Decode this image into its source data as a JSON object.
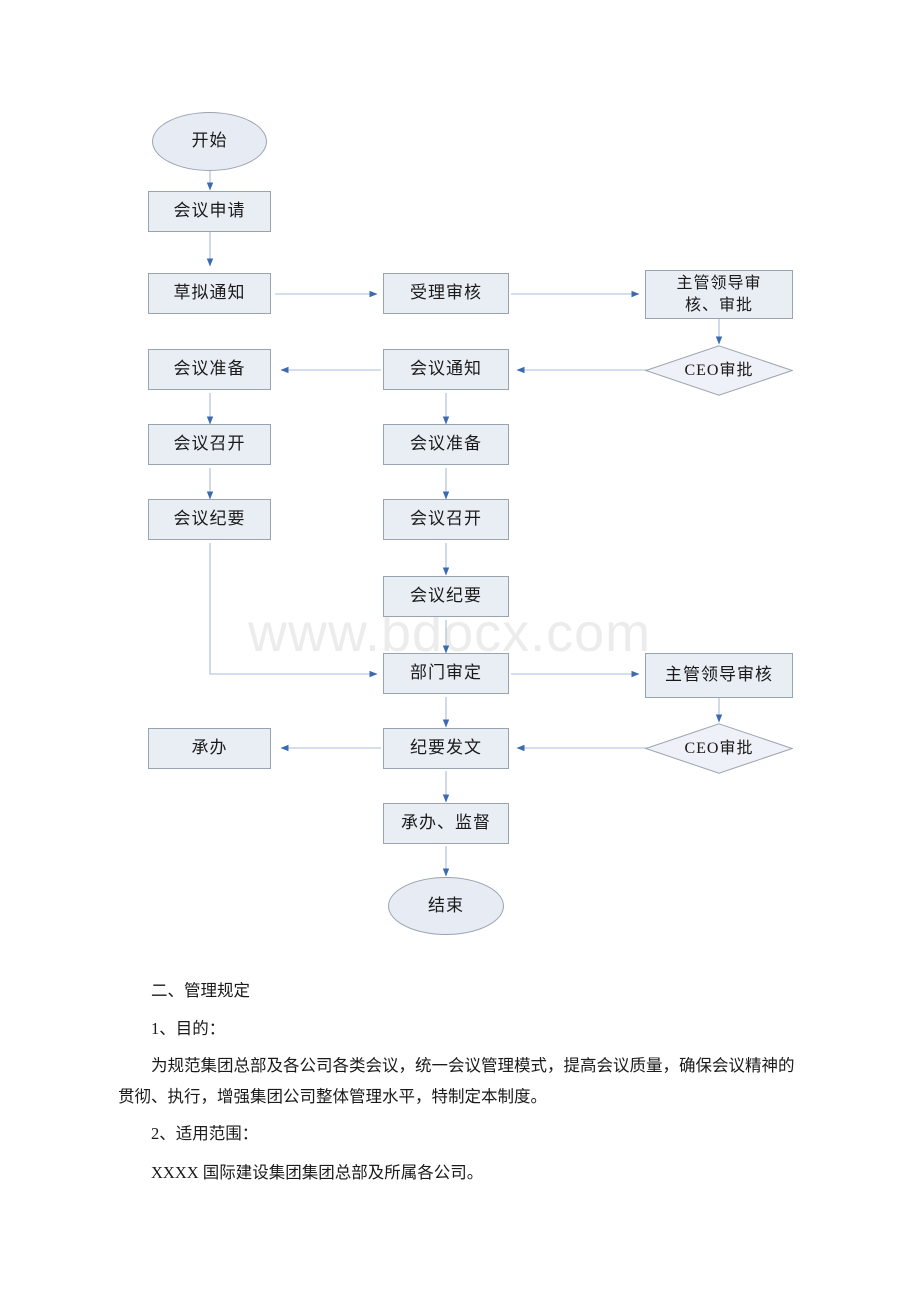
{
  "watermark": {
    "text": "www.bdocx.com"
  },
  "flowchart": {
    "nodes": {
      "start": {
        "label": "开始"
      },
      "meeting_apply": {
        "label": "会议申请"
      },
      "draft_notice": {
        "label": "草拟通知"
      },
      "accept_review": {
        "label": "受理审核"
      },
      "leader_review_1": {
        "label": "主管领导审\n核、审批",
        "line1": "主管领导审",
        "line2": "核、审批"
      },
      "ceo_approve_1": {
        "label": "CEO审批"
      },
      "meeting_notice": {
        "label": "会议通知"
      },
      "prepare_left": {
        "label": "会议准备"
      },
      "hold_left": {
        "label": "会议召开"
      },
      "minutes_left": {
        "label": "会议纪要"
      },
      "prepare_mid": {
        "label": "会议准备"
      },
      "hold_mid": {
        "label": "会议召开"
      },
      "minutes_mid": {
        "label": "会议纪要"
      },
      "dept_approve": {
        "label": "部门审定"
      },
      "leader_review_2": {
        "label": "主管领导审核"
      },
      "ceo_approve_2": {
        "label": "CEO审批"
      },
      "minutes_issue": {
        "label": "纪要发文"
      },
      "undertake_left": {
        "label": "承办"
      },
      "undertake_super": {
        "label": "承办、监督"
      },
      "end": {
        "label": "结束"
      }
    },
    "colors": {
      "node_fill": "#e9eef5",
      "node_border": "#9aa4b0",
      "connector": "#9fb4d4",
      "arrow": "#3b6ab0"
    }
  },
  "document": {
    "section_heading": "二、管理规定",
    "item1_heading": "1、目的：",
    "item1_body": "为规范集团总部及各公司各类会议，统一会议管理模式，提高会议质量，确保会议精神的贯彻、执行，增强集团公司整体管理水平，特制定本制度。",
    "item2_heading": "2、适用范围：",
    "item2_body": "XXXX 国际建设集团集团总部及所属各公司。"
  }
}
